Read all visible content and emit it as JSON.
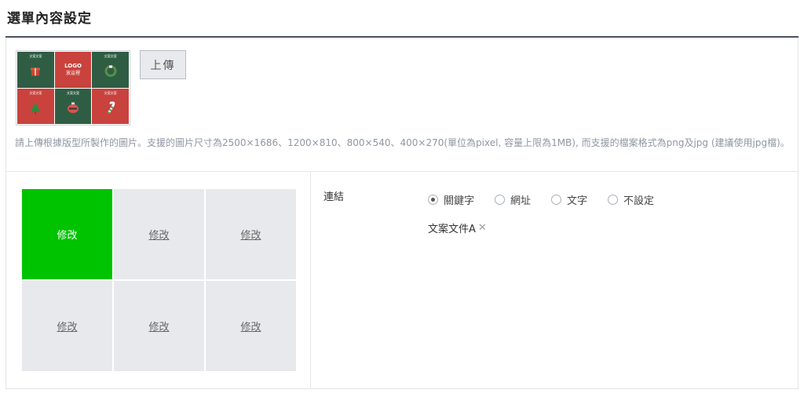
{
  "page": {
    "title": "選單內容設定"
  },
  "upload": {
    "button_label": "上傳",
    "note": "請上傳根據版型所製作的圖片。支援的圖片尺寸為2500×1686、1200×810、800×540、400×270(單位為pixel, 容量上限為1MB), 而支援的檔案格式為png及jpg (建議使用jpg檔)。",
    "thumbnail": {
      "logo_text": "LOGO",
      "logo_sub": "放這裡",
      "cells": [
        {
          "label": "文案文案",
          "icon": "gift-icon",
          "bg": "#2f5d44"
        },
        {
          "label": "",
          "icon": "logo",
          "bg": "#c9423d"
        },
        {
          "label": "文案文案",
          "icon": "wreath-icon",
          "bg": "#2f5d44"
        },
        {
          "label": "文案文案",
          "icon": "tree-icon",
          "bg": "#c9423d"
        },
        {
          "label": "文案文案",
          "icon": "ornament-icon",
          "bg": "#2f5d44"
        },
        {
          "label": "文案文案",
          "icon": "candy-cane-icon",
          "bg": "#c9423d"
        }
      ]
    }
  },
  "grid": {
    "cells": [
      {
        "label": "修改",
        "active": true
      },
      {
        "label": "修改",
        "active": false
      },
      {
        "label": "修改",
        "active": false
      },
      {
        "label": "修改",
        "active": false
      },
      {
        "label": "修改",
        "active": false
      },
      {
        "label": "修改",
        "active": false
      }
    ],
    "active_color": "#00c300"
  },
  "link": {
    "label": "連結",
    "options": [
      {
        "label": "關鍵字",
        "checked": true
      },
      {
        "label": "網址",
        "checked": false
      },
      {
        "label": "文字",
        "checked": false
      },
      {
        "label": "不設定",
        "checked": false
      }
    ],
    "tag": {
      "text": "文案文件A",
      "close_icon": "close-icon"
    }
  }
}
